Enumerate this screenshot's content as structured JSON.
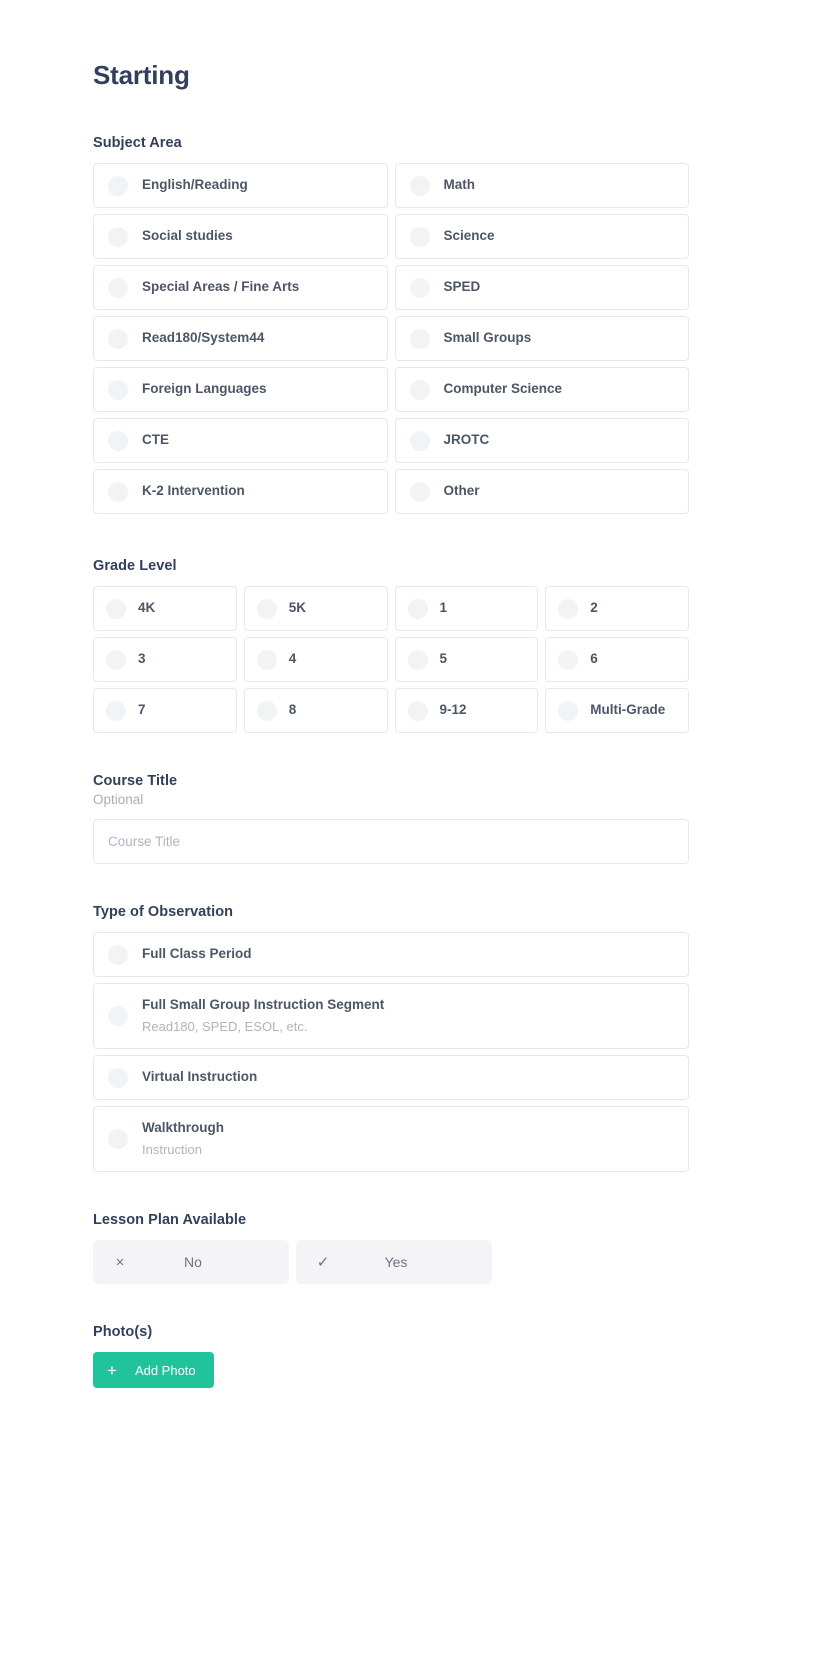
{
  "page": {
    "title": "Starting"
  },
  "subject_area": {
    "label": "Subject Area",
    "options": [
      {
        "label": "English/Reading"
      },
      {
        "label": "Math"
      },
      {
        "label": "Social studies"
      },
      {
        "label": "Science"
      },
      {
        "label": "Special Areas / Fine Arts"
      },
      {
        "label": "SPED"
      },
      {
        "label": "Read180/System44"
      },
      {
        "label": "Small Groups"
      },
      {
        "label": "Foreign Languages"
      },
      {
        "label": "Computer Science"
      },
      {
        "label": "CTE"
      },
      {
        "label": "JROTC"
      },
      {
        "label": "K-2 Intervention"
      },
      {
        "label": "Other"
      }
    ]
  },
  "grade_level": {
    "label": "Grade Level",
    "options": [
      {
        "label": "4K"
      },
      {
        "label": "5K"
      },
      {
        "label": "1"
      },
      {
        "label": "2"
      },
      {
        "label": "3"
      },
      {
        "label": "4"
      },
      {
        "label": "5"
      },
      {
        "label": "6"
      },
      {
        "label": "7"
      },
      {
        "label": "8"
      },
      {
        "label": "9-12"
      },
      {
        "label": "Multi-Grade"
      }
    ]
  },
  "course_title": {
    "label": "Course Title",
    "sublabel": "Optional",
    "value": "",
    "placeholder": "Course Title"
  },
  "type_of_observation": {
    "label": "Type of Observation",
    "options": [
      {
        "label": "Full Class Period",
        "sub": ""
      },
      {
        "label": "Full Small Group Instruction Segment",
        "sub": "Read180, SPED, ESOL, etc."
      },
      {
        "label": "Virtual Instruction",
        "sub": ""
      },
      {
        "label": "Walkthrough",
        "sub": "Instruction"
      }
    ]
  },
  "lesson_plan": {
    "label": "Lesson Plan Available",
    "no_icon": "×",
    "no_label": "No",
    "yes_icon": "✓",
    "yes_label": "Yes"
  },
  "photos": {
    "label": "Photo(s)",
    "add_icon": "+",
    "add_label": "Add Photo"
  },
  "colors": {
    "heading": "#32405b",
    "body": "#4d5667",
    "muted": "#b0b4bd",
    "border": "#e6e8ec",
    "radio": "#f2f3f5",
    "toggle_bg": "#f4f4f6",
    "accent": "#21c39b"
  }
}
